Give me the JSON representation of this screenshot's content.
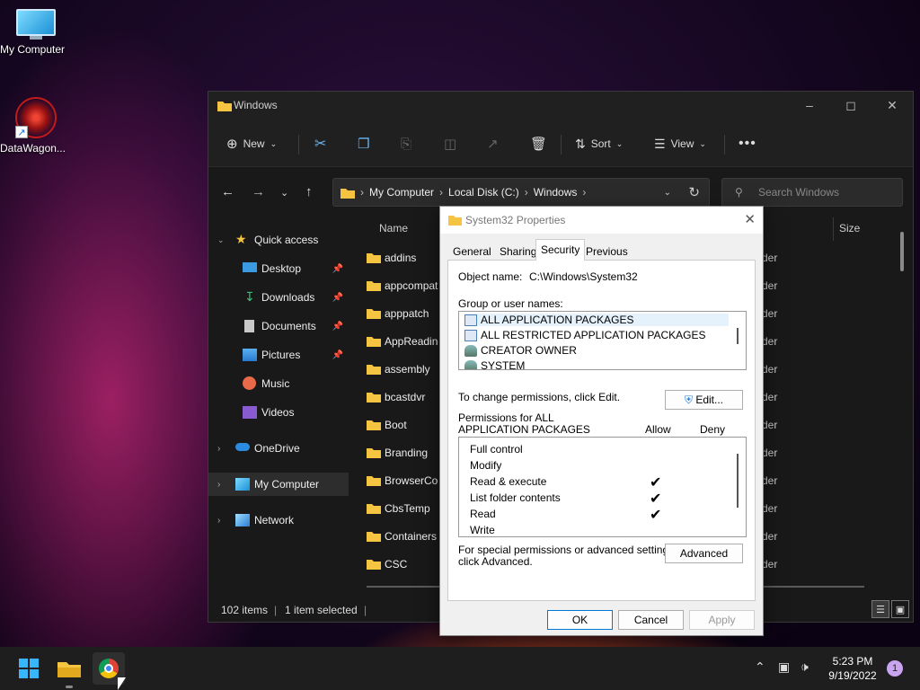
{
  "desktop": {
    "icons": [
      {
        "label": "My Computer"
      },
      {
        "label": "DataWagon..."
      }
    ]
  },
  "explorer": {
    "title": "Windows",
    "toolbar": {
      "new_label": "New",
      "sort_label": "Sort",
      "view_label": "View"
    },
    "breadcrumb": [
      "My Computer",
      "Local Disk (C:)",
      "Windows"
    ],
    "search_placeholder": "Search Windows",
    "nav": {
      "quick_access": "Quick access",
      "items": [
        {
          "label": "Desktop",
          "pinned": true
        },
        {
          "label": "Downloads",
          "pinned": true
        },
        {
          "label": "Documents",
          "pinned": true
        },
        {
          "label": "Pictures",
          "pinned": true
        },
        {
          "label": "Music",
          "pinned": false
        },
        {
          "label": "Videos",
          "pinned": false
        }
      ],
      "onedrive": "OneDrive",
      "my_computer": "My Computer",
      "network": "Network"
    },
    "columns": {
      "name": "Name",
      "size": "Size"
    },
    "files": [
      "addins",
      "appcompat",
      "apppatch",
      "AppReadiness",
      "assembly",
      "bcastdvr",
      "Boot",
      "Branding",
      "BrowserCore",
      "CbsTemp",
      "Containers",
      "CSC"
    ],
    "type_fragment": "der",
    "status": {
      "items": "102 items",
      "selected": "1 item selected"
    }
  },
  "dialog": {
    "title": "System32 Properties",
    "tabs": [
      "General",
      "Sharing",
      "Security",
      "Previous Versions"
    ],
    "active_tab": "Security",
    "object_label": "Object name:",
    "object_value": "C:\\Windows\\System32",
    "group_label": "Group or user names:",
    "groups": [
      "ALL APPLICATION PACKAGES",
      "ALL RESTRICTED APPLICATION PACKAGES",
      "CREATOR OWNER",
      "SYSTEM"
    ],
    "change_text": "To change permissions, click Edit.",
    "edit_label": "Edit...",
    "perm_for_line1": "Permissions for ALL",
    "perm_for_line2": "APPLICATION PACKAGES",
    "allow_label": "Allow",
    "deny_label": "Deny",
    "permissions": [
      {
        "name": "Full control",
        "allow": false
      },
      {
        "name": "Modify",
        "allow": false
      },
      {
        "name": "Read & execute",
        "allow": true
      },
      {
        "name": "List folder contents",
        "allow": true
      },
      {
        "name": "Read",
        "allow": true
      },
      {
        "name": "Write",
        "allow": false
      }
    ],
    "special_line1": "For special permissions or advanced settings,",
    "special_line2": "click Advanced.",
    "advanced_label": "Advanced",
    "ok_label": "OK",
    "cancel_label": "Cancel",
    "apply_label": "Apply"
  },
  "taskbar": {
    "time": "5:23 PM",
    "date": "9/19/2022",
    "notifications": "1"
  }
}
